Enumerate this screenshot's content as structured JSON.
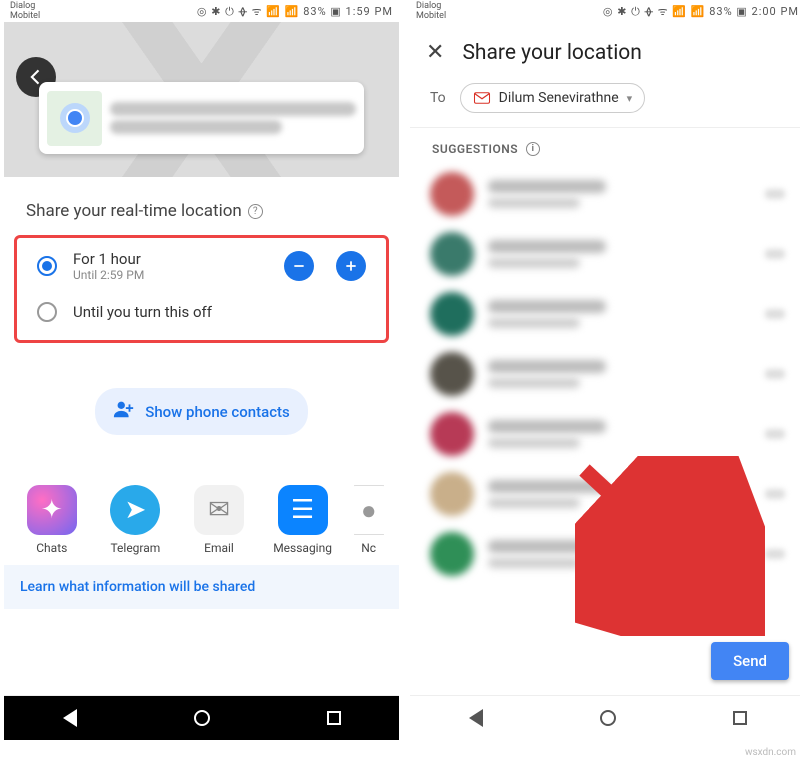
{
  "statusbar": {
    "carrier": "Dialog\nMobitel",
    "icons": "◎ ✱ ⏻ ᚖ ᯤ 📶 📶 83% ▣",
    "time_left": "1:59 PM",
    "time_right": "2:00 PM"
  },
  "left": {
    "share_title": "Share your real-time location",
    "options": {
      "for1hour_label": "For 1 hour",
      "for1hour_sub": "Until 2:59 PM",
      "until_off_label": "Until you turn this off"
    },
    "show_contacts": "Show phone contacts",
    "share_apps": {
      "chats": "Chats",
      "telegram": "Telegram",
      "email": "Email",
      "messaging": "Messaging",
      "notes": "Nc"
    },
    "learn": "Learn what information will be shared"
  },
  "right": {
    "header": "Share your location",
    "to_label": "To",
    "chip_name": "Dilum Senevirathne",
    "suggestions_label": "SUGGESTIONS",
    "send": "Send",
    "avatar_colors": [
      "#c45a5a",
      "#3a7a6b",
      "#1f6e5d",
      "#57534a",
      "#b73a56",
      "#c9af8a",
      "#2f8f57"
    ]
  },
  "watermark": "wsxdn.com"
}
